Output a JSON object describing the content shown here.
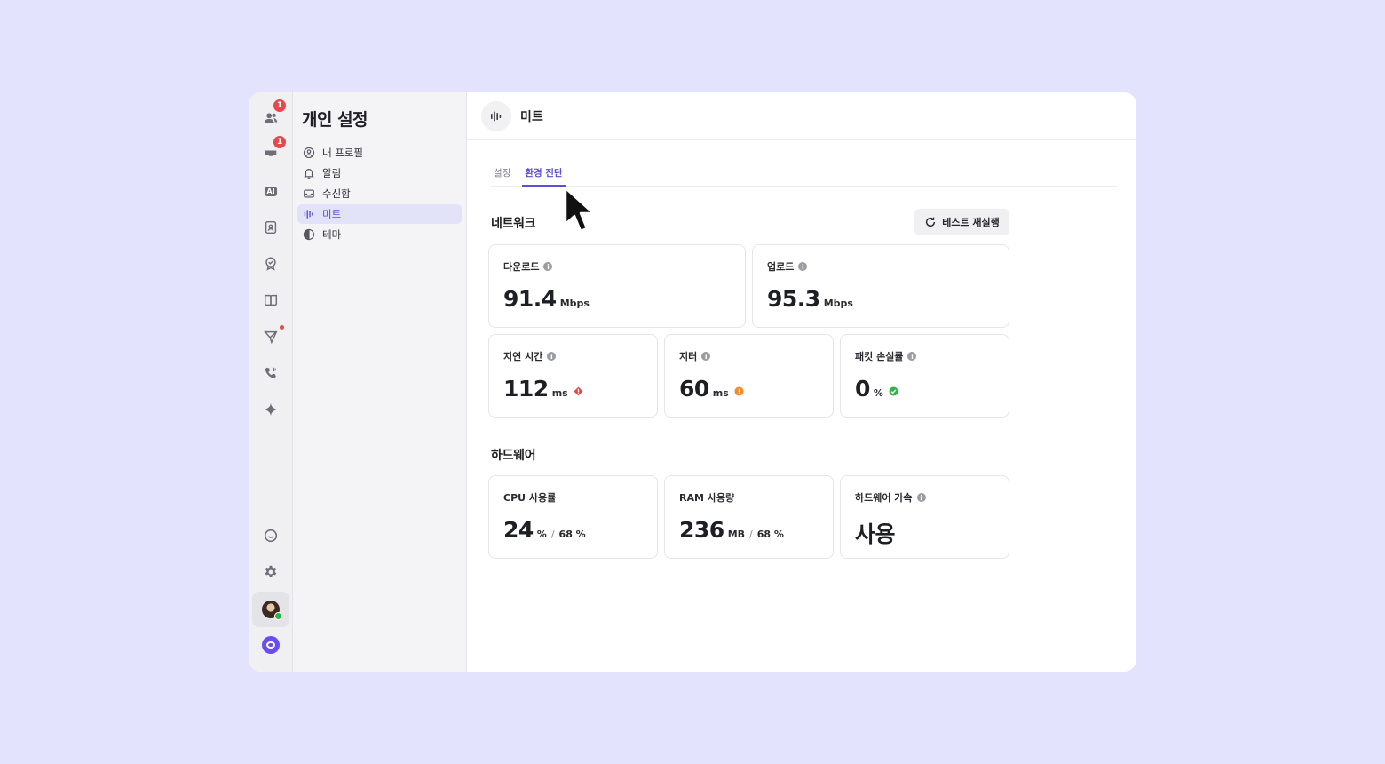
{
  "rail": {
    "badges": {
      "contacts": "1",
      "inbox": "1"
    },
    "ai_label": "AI"
  },
  "sidebar": {
    "title": "개인 설정",
    "items": [
      {
        "label": "내 프로필",
        "icon": "profile-icon"
      },
      {
        "label": "알림",
        "icon": "bell-icon"
      },
      {
        "label": "수신함",
        "icon": "inbox-icon"
      },
      {
        "label": "미트",
        "icon": "audio-wave-icon",
        "active": true
      },
      {
        "label": "테마",
        "icon": "theme-icon"
      }
    ]
  },
  "header": {
    "title": "미트"
  },
  "tabs": [
    {
      "label": "설정",
      "active": false
    },
    {
      "label": "환경 진단",
      "active": true
    }
  ],
  "network": {
    "title": "네트워크",
    "retest_label": "테스트 재실행",
    "download": {
      "label": "다운로드",
      "value": "91.4",
      "unit": "Mbps"
    },
    "upload": {
      "label": "업로드",
      "value": "95.3",
      "unit": "Mbps"
    },
    "latency": {
      "label": "지연 시간",
      "value": "112",
      "unit": "ms",
      "status": "error"
    },
    "jitter": {
      "label": "지터",
      "value": "60",
      "unit": "ms",
      "status": "warning"
    },
    "packet_loss": {
      "label": "패킷 손실률",
      "value": "0",
      "unit": "%",
      "status": "ok"
    }
  },
  "hardware": {
    "title": "하드웨어",
    "cpu": {
      "label": "CPU 사용률",
      "value": "24",
      "unit": "%",
      "secondary": "68 %"
    },
    "ram": {
      "label": "RAM 사용량",
      "value": "236",
      "unit": "MB",
      "secondary": "68 %"
    },
    "acceleration": {
      "label": "하드웨어 가속",
      "value": "사용"
    }
  },
  "colors": {
    "accent": "#5b4fd8",
    "error": "#e5484d",
    "warning": "#f08c2a",
    "ok": "#2fb34a",
    "background": "#e3e3fd"
  }
}
